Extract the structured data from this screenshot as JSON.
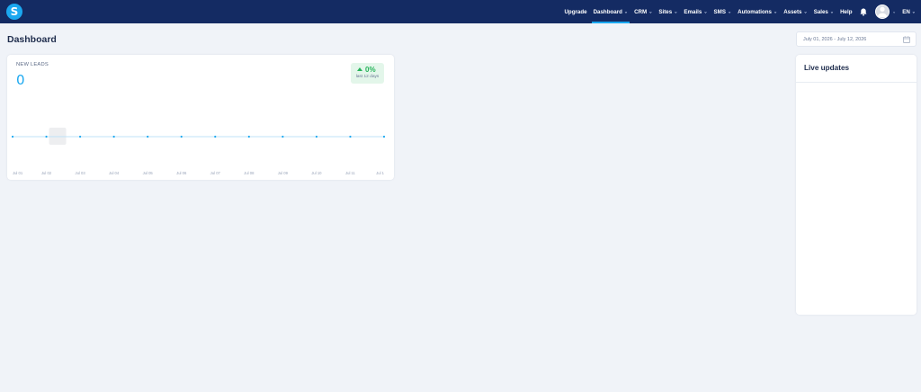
{
  "app": {
    "logo_letter": "S"
  },
  "nav": {
    "items": [
      {
        "label": "Upgrade",
        "dropdown": false,
        "active": false
      },
      {
        "label": "Dashboard",
        "dropdown": true,
        "active": true
      },
      {
        "label": "CRM",
        "dropdown": true,
        "active": false
      },
      {
        "label": "Sites",
        "dropdown": true,
        "active": false
      },
      {
        "label": "Emails",
        "dropdown": true,
        "active": false
      },
      {
        "label": "SMS",
        "dropdown": true,
        "active": false
      },
      {
        "label": "Automations",
        "dropdown": true,
        "active": false
      },
      {
        "label": "Assets",
        "dropdown": true,
        "active": false
      },
      {
        "label": "Sales",
        "dropdown": true,
        "active": false
      },
      {
        "label": "Help",
        "dropdown": false,
        "active": false
      }
    ],
    "bell_icon": "bell-icon",
    "avatar_icon": "user-avatar",
    "language": "EN"
  },
  "page": {
    "title": "Dashboard",
    "date_range": "July 01, 2026 - July 12, 2026"
  },
  "leads": {
    "label": "NEW LEADS",
    "value": "0",
    "change": "0%",
    "change_period": "last 12 days",
    "accent": "#1ba8f0",
    "positive_color": "#26b35a"
  },
  "chart_data": {
    "type": "line",
    "x": [
      "Jul 01",
      "Jul 02",
      "Jul 03",
      "Jul 04",
      "Jul 05",
      "Jul 06",
      "Jul 07",
      "Jul 08",
      "Jul 09",
      "Jul 10",
      "Jul 11",
      "Jul 1"
    ],
    "series": [
      {
        "values": [
          0,
          0,
          0,
          0,
          0,
          0,
          0,
          0,
          0,
          0,
          0,
          0
        ]
      }
    ],
    "title": "",
    "xlabel": "",
    "ylabel": "",
    "grid": false,
    "color": "#1ba8f0"
  },
  "live": {
    "title": "Live updates"
  }
}
